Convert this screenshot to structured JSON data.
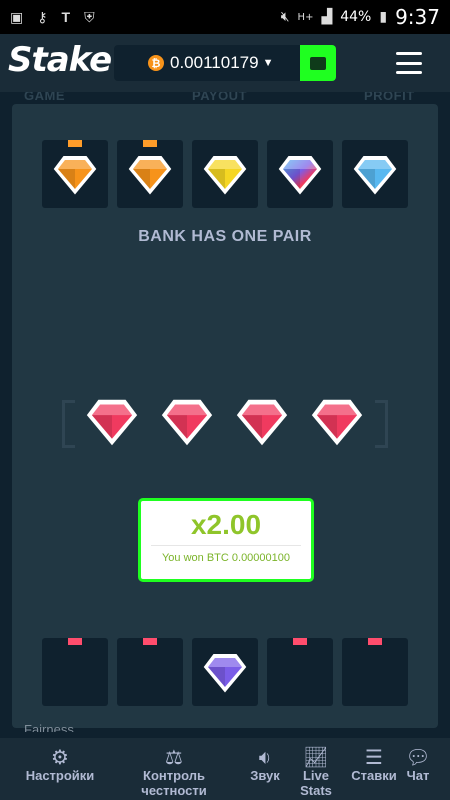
{
  "status_bar": {
    "icons": [
      "image-icon",
      "key-icon",
      "t-icon",
      "shield-icon",
      "mute-icon",
      "signal-icon"
    ],
    "network": "H+",
    "battery": "44%",
    "time": "9:37"
  },
  "header": {
    "logo": "Stake",
    "balance": "0.00110179",
    "currency_icon": "bitcoin-icon",
    "currency_symbol": "₿"
  },
  "background_headers": [
    "GAME",
    "PAYOUT",
    "PROFIT"
  ],
  "bank_cards": [
    {
      "gem": "orange",
      "has_tab": true
    },
    {
      "gem": "orange",
      "has_tab": true
    },
    {
      "gem": "yellow",
      "has_tab": false
    },
    {
      "gem": "multicolor",
      "has_tab": false
    },
    {
      "gem": "blue",
      "has_tab": false
    }
  ],
  "bank_message": "BANK HAS ONE PAIR",
  "middle_gems": [
    "red",
    "red",
    "red",
    "red"
  ],
  "win": {
    "multiplier": "x2.00",
    "message": "You won BTC 0.00000100"
  },
  "player_cards": [
    {
      "gem": null,
      "has_tab": true
    },
    {
      "gem": null,
      "has_tab": true
    },
    {
      "gem": "purple",
      "has_tab": false
    },
    {
      "gem": null,
      "has_tab": true
    },
    {
      "gem": null,
      "has_tab": true
    }
  ],
  "bottom_fragment": "Fairness",
  "nav": [
    {
      "icon": "gear-icon",
      "label": "Настройки"
    },
    {
      "icon": "scale-icon",
      "label": "Контроль честности"
    },
    {
      "icon": "speaker-icon",
      "label": "Звук"
    },
    {
      "icon": "chart-icon",
      "label": "Live Stats"
    },
    {
      "icon": "list-icon",
      "label": "Ставки"
    },
    {
      "icon": "chat-icon",
      "label": "Чат"
    }
  ],
  "colors": {
    "orange": "#f7931a",
    "yellow": "#f5d623",
    "blue": "#58b8f0",
    "red": "#f03a5f",
    "purple": "#7b5de8",
    "accent_green": "#1fff20",
    "tab_orange": "#ff9d2a",
    "tab_pink": "#ff4d6d"
  }
}
